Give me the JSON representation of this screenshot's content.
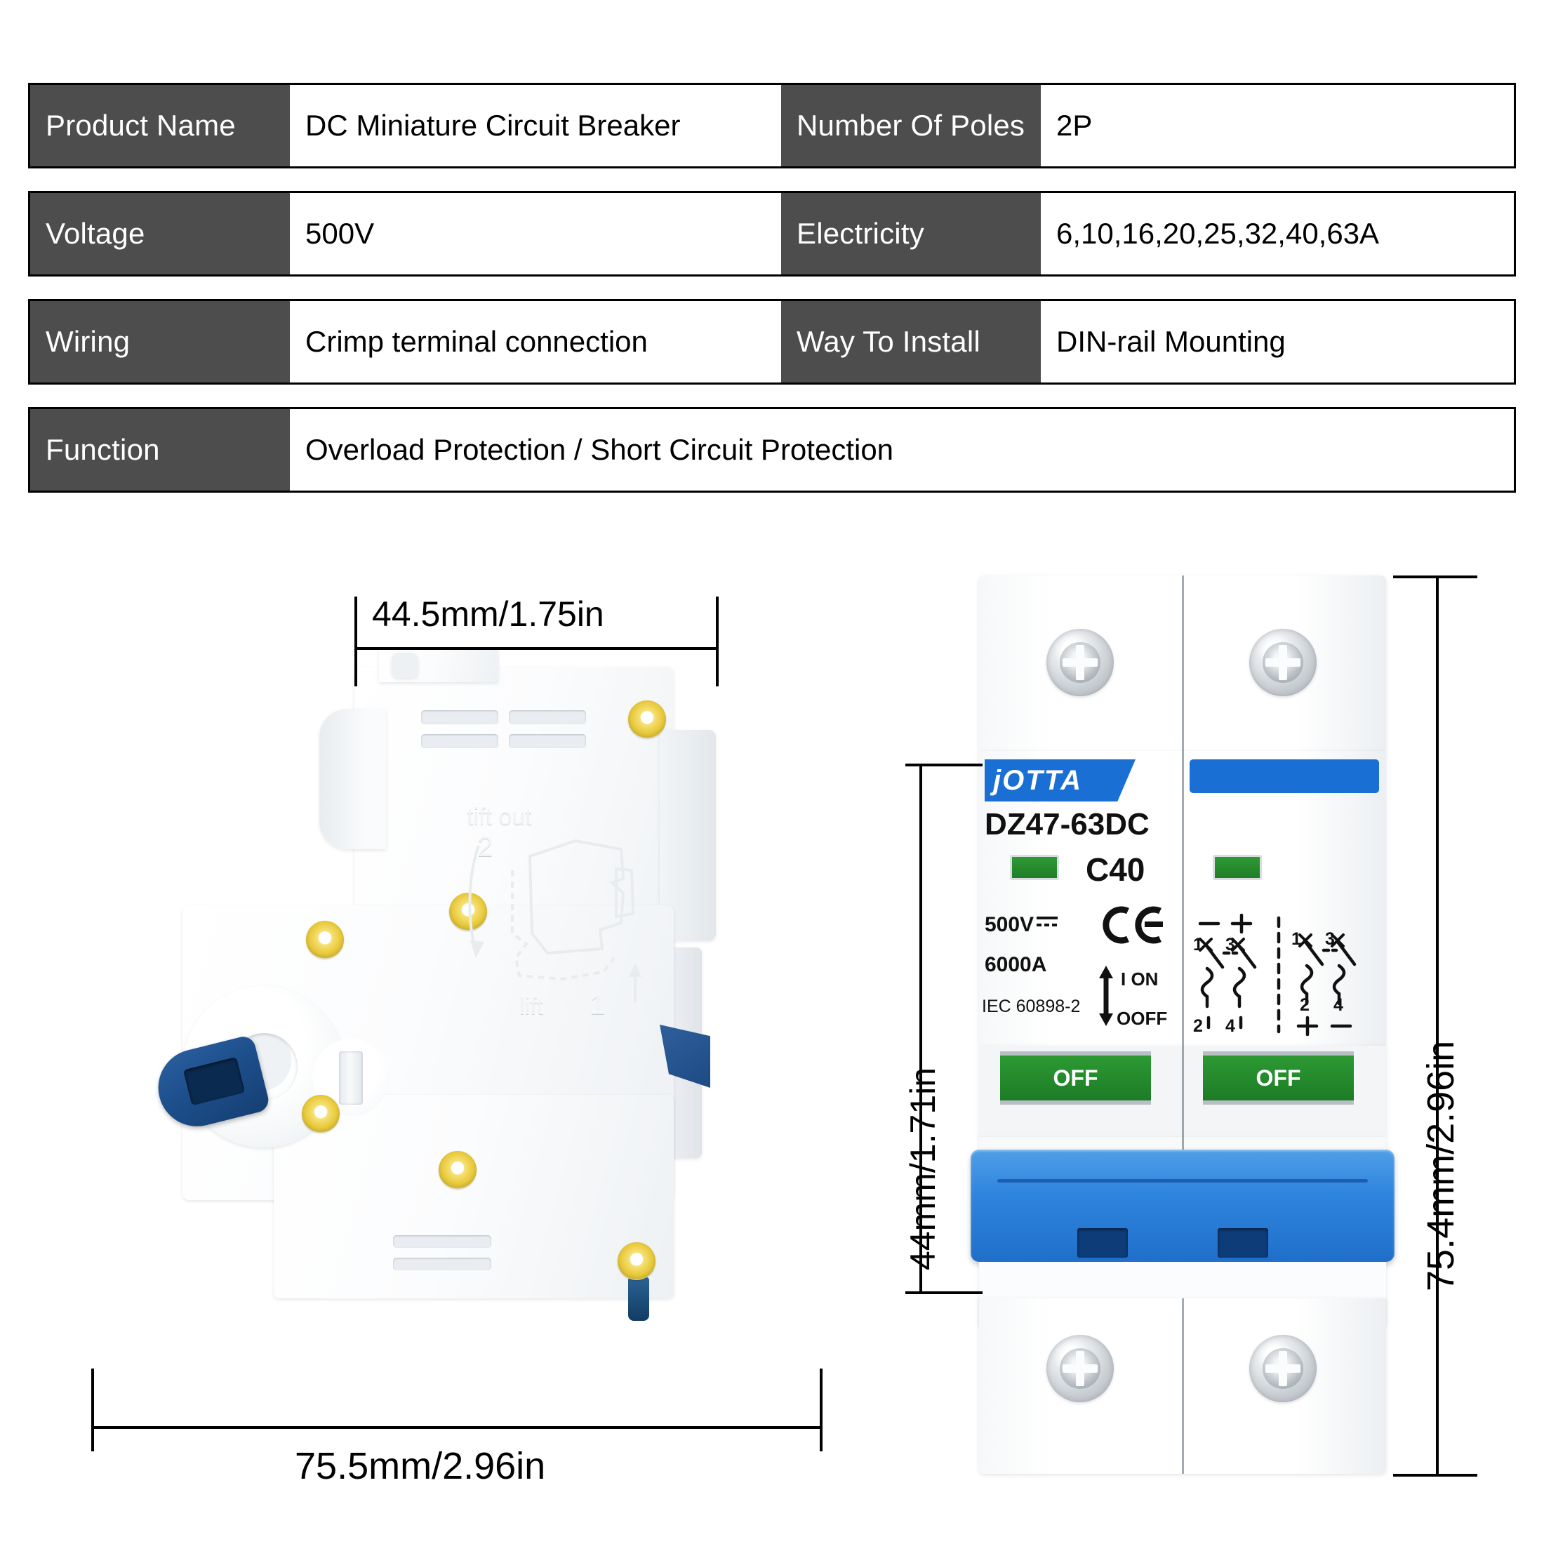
{
  "spec_table": {
    "rows": [
      {
        "key1": "Product Name",
        "val1": "DC Miniature Circuit Breaker",
        "key2": "Number Of Poles",
        "val2": "2P"
      },
      {
        "key1": "Voltage",
        "val1": "500V",
        "key2": "Electricity",
        "val2": "6,10,16,20,25,32,40,63A"
      },
      {
        "key1": "Wiring",
        "val1": "Crimp terminal connection",
        "key2": "Way To Install",
        "val2": "DIN-rail Mounting"
      }
    ],
    "full_row": {
      "key": "Function",
      "val": "Overload Protection / Short Circuit Protection"
    }
  },
  "dimensions": {
    "side_width": "44.5mm/1.75in",
    "side_height": "75.5mm/2.96in",
    "front_body_height": "44mm/1.71in",
    "front_total_height": "75.4mm/2.96in"
  },
  "side_view": {
    "emboss_lift_out": "tift out",
    "emboss_number_2": "2",
    "emboss_lift": "lift",
    "emboss_number_1": "1"
  },
  "front_view": {
    "brand": "jOTTA",
    "model": "DZ47-63DC",
    "rating": "C40",
    "voltage": "500V",
    "dc_symbol": "═",
    "breaking_capacity": "6000A",
    "standard": "IEC 60898-2",
    "ce_mark": "CE",
    "on_label": "I ON",
    "off_label": "OOFF",
    "switch_state_left": "OFF",
    "switch_state_right": "OFF",
    "schematic": {
      "left_top_minus": "−",
      "left_top_plus": "+",
      "left_terminals_top": [
        "1",
        "3"
      ],
      "left_terminals_bottom": [
        "2",
        "4"
      ],
      "right_terminals_top": [
        "1",
        "3"
      ],
      "right_terminals_bottom": [
        "2",
        "4"
      ],
      "right_bottom_plus": "+",
      "right_bottom_minus": "−"
    }
  },
  "colors": {
    "header_gray": "#4d4d4d",
    "brand_blue": "#1a6fd4",
    "handle_blue": "#2f84dd",
    "led_green": "#1f7d27",
    "rivet_gold": "#e8c93a",
    "border_black": "#000000"
  }
}
